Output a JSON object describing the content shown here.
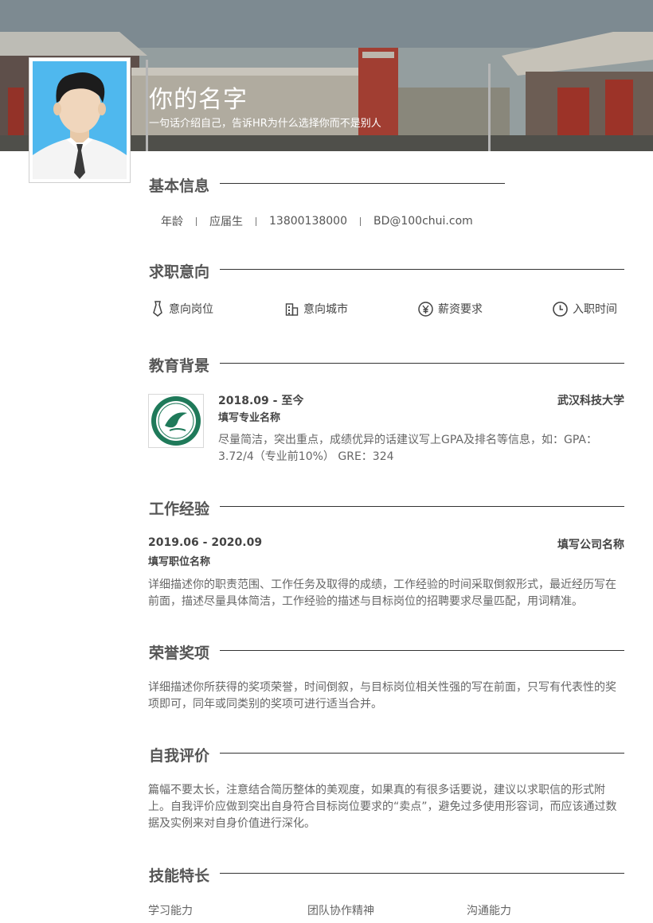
{
  "header": {
    "name": "你的名字",
    "tagline": "一句话介绍自己，告诉HR为什么选择你而不是别人"
  },
  "basic": {
    "title": "基本信息",
    "items": [
      "年龄",
      "应届生",
      "13800138000",
      "BD@100chui.com"
    ]
  },
  "intent": {
    "title": "求职意向",
    "items": [
      {
        "icon": "tie-icon",
        "label": "意向岗位"
      },
      {
        "icon": "building-icon",
        "label": "意向城市"
      },
      {
        "icon": "yen-icon",
        "label": "薪资要求"
      },
      {
        "icon": "clock-icon",
        "label": "入职时间"
      }
    ]
  },
  "education": {
    "title": "教育背景",
    "period": "2018.09 - 至今",
    "school": "武汉科技大学",
    "major": "填写专业名称",
    "desc": "尽量简洁，突出重点，成绩优异的话建议写上GPA及排名等信息，如：GPA：3.72/4（专业前10%） GRE：324"
  },
  "work": {
    "title": "工作经验",
    "period": "2019.06 - 2020.09",
    "company": "填写公司名称",
    "position": "填写职位名称",
    "desc": "详细描述你的职责范围、工作任务及取得的成绩，工作经验的时间采取倒叙形式，最近经历写在前面，描述尽量具体简洁，工作经验的描述与目标岗位的招聘要求尽量匹配，用词精准。"
  },
  "honors": {
    "title": "荣誉奖项",
    "desc": "详细描述你所获得的奖项荣誉，时间倒叙，与目标岗位相关性强的写在前面，只写有代表性的奖项即可，同年或同类别的奖项可进行适当合并。"
  },
  "self": {
    "title": "自我评价",
    "desc": "篇幅不要太长，注意结合简历整体的美观度，如果真的有很多话要说，建议以求职信的形式附上。自我评价应做到突出自身符合目标岗位要求的“卖点”，避免过多使用形容词，而应该通过数据及实例来对自身价值进行深化。"
  },
  "skills": {
    "title": "技能特长",
    "items": [
      "学习能力",
      "团队协作精神",
      "沟通能力"
    ]
  },
  "colors": {
    "accent": "#333333",
    "text": "#555555",
    "avatar_bg": "#4fb8ee",
    "logo_green": "#1f7a5a"
  }
}
